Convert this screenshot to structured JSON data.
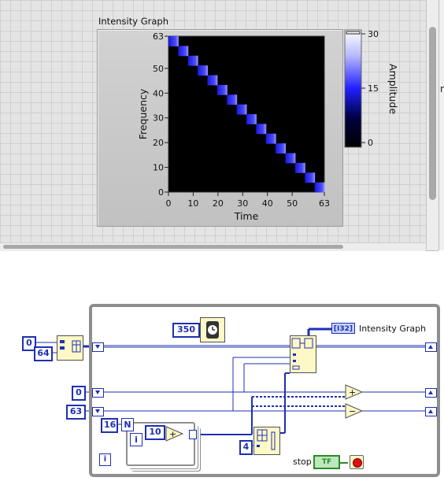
{
  "front_panel": {
    "graph_title": "Intensity Graph",
    "y_axis_label": "Frequency",
    "x_axis_label": "Time",
    "y_ticks": [
      "63",
      "50",
      "40",
      "30",
      "20",
      "10",
      "0"
    ],
    "x_ticks": [
      "0",
      "10",
      "20",
      "30",
      "40",
      "50",
      "63"
    ],
    "colorbar_label": "Amplitude",
    "colorbar_ticks": [
      "30",
      "15",
      "0"
    ],
    "right_clip_char": "n"
  },
  "block_diagram": {
    "const_0_top": "0",
    "const_64": "64",
    "const_350": "350",
    "const_0_mid": "0",
    "const_63": "63",
    "const_16": "16",
    "const_N": "N",
    "const_i_inner": "i",
    "const_10": "10",
    "const_4": "4",
    "loop_i": "i",
    "indicator_type": "[I32]",
    "indicator_label": "Intensity Graph",
    "stop_label": "stop",
    "stop_tf": "TF"
  },
  "colors": {
    "wire_blue": "#1e2fb4",
    "stop_green": "#2a8a2a",
    "graph_bg": "#000000",
    "trace": "#3a3aff"
  }
}
